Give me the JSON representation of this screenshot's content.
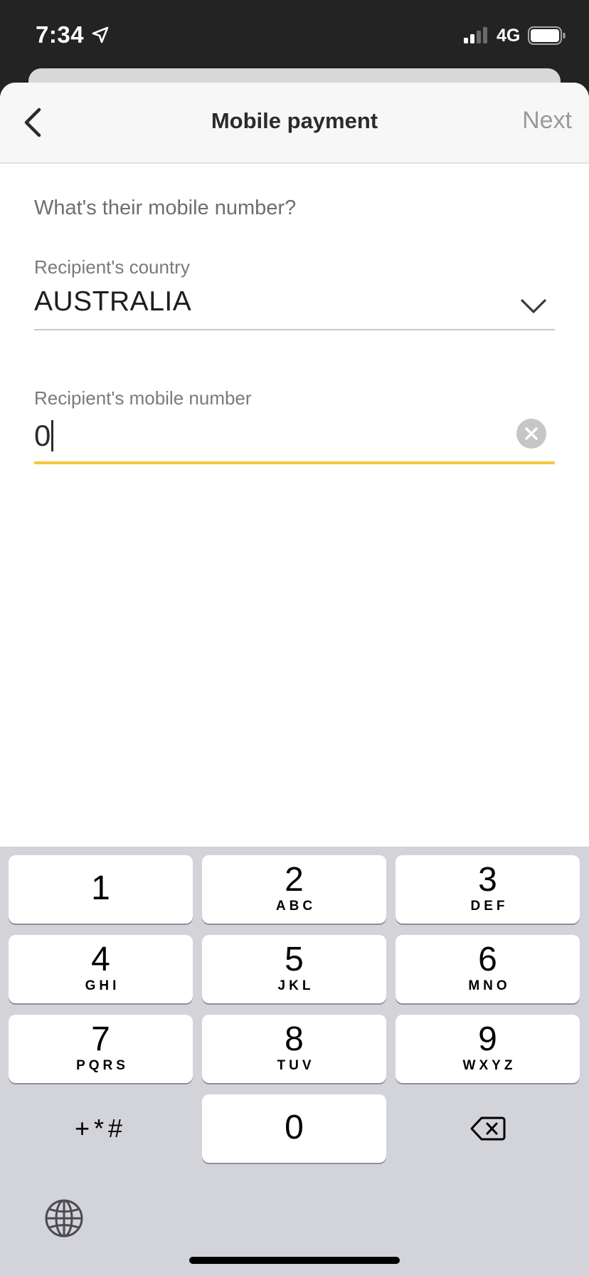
{
  "status_bar": {
    "time": "7:34",
    "network": "4G",
    "icons": [
      "location-arrow-icon",
      "signal-icon",
      "battery-icon"
    ]
  },
  "nav": {
    "back_icon": "chevron-left-icon",
    "title": "Mobile payment",
    "next_label": "Next"
  },
  "form": {
    "prompt": "What's their mobile number?",
    "country_label": "Recipient's country",
    "country_value": "AUSTRALIA",
    "mobile_label": "Recipient's mobile number",
    "mobile_value": "0"
  },
  "keyboard": {
    "keys": [
      {
        "digit": "1",
        "letters": ""
      },
      {
        "digit": "2",
        "letters": "ABC"
      },
      {
        "digit": "3",
        "letters": "DEF"
      },
      {
        "digit": "4",
        "letters": "GHI"
      },
      {
        "digit": "5",
        "letters": "JKL"
      },
      {
        "digit": "6",
        "letters": "MNO"
      },
      {
        "digit": "7",
        "letters": "PQRS"
      },
      {
        "digit": "8",
        "letters": "TUV"
      },
      {
        "digit": "9",
        "letters": "WXYZ"
      },
      {
        "digit": "0",
        "letters": ""
      }
    ],
    "symbols_label": "+*#",
    "delete_icon": "backspace-icon",
    "globe_icon": "globe-icon"
  },
  "colors": {
    "accent_underline": "#f5c93b",
    "status_bar_bg": "#232323",
    "keyboard_bg": "#d3d4d9",
    "next_disabled": "#9a9a9a"
  }
}
